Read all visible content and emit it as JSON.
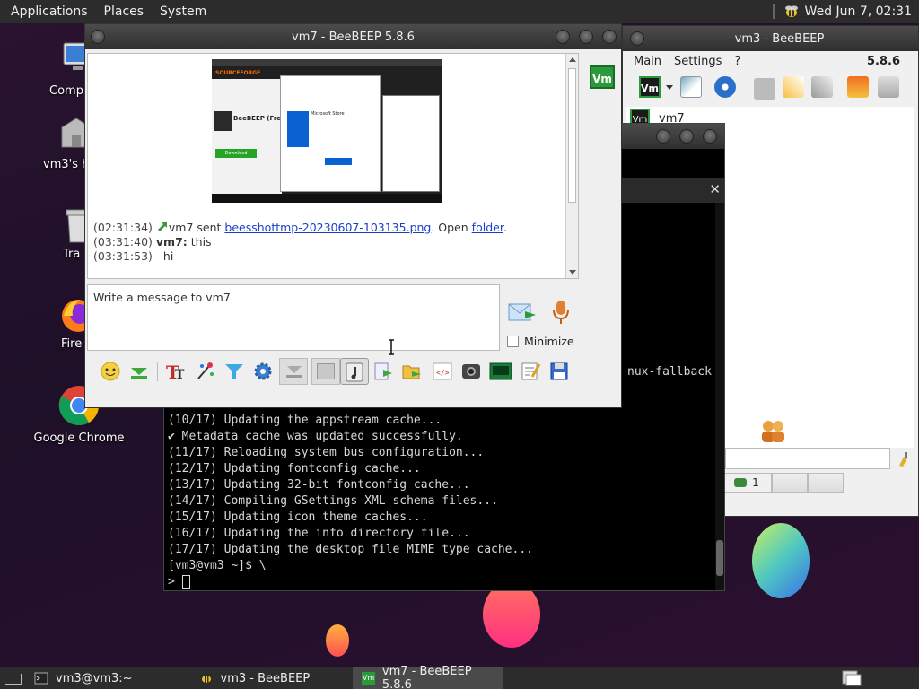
{
  "top_panel": {
    "menus": [
      "Applications",
      "Places",
      "System"
    ],
    "clock": "Wed Jun  7, 02:31"
  },
  "desktop": {
    "icons": [
      {
        "label": "Comp",
        "icon": "computer-icon"
      },
      {
        "label": "vm3's h",
        "icon": "home-folder-icon"
      },
      {
        "label": "Tra",
        "icon": "trash-icon"
      },
      {
        "label": "Fire",
        "icon": "firefox-icon"
      },
      {
        "label": "Google Chrome",
        "icon": "chrome-icon"
      }
    ]
  },
  "bottom_panel": {
    "tasks": [
      {
        "label": "vm3@vm3:~",
        "icon": "terminal-icon"
      },
      {
        "label": "vm3 - BeeBEEP",
        "icon": "beebeep-icon"
      },
      {
        "label": "vm7 - BeeBEEP 5.8.6",
        "icon": "vm-avatar-icon"
      }
    ]
  },
  "terminal": {
    "partial": "nux-fallback",
    "lines": [
      "(10/17) Updating the appstream cache...",
      "✔ Metadata cache was updated successfully.",
      "(11/17) Reloading system bus configuration...",
      "(12/17) Updating fontconfig cache...",
      "(13/17) Updating 32-bit fontconfig cache...",
      "(14/17) Compiling GSettings XML schema files...",
      "(15/17) Updating icon theme caches...",
      "(16/17) Updating the info directory file...",
      "(17/17) Updating the desktop file MIME type cache...",
      "[vm3@vm3 ~]$ \\",
      ">"
    ]
  },
  "bg_window": {
    "title": "vm3 - BeeBEEP",
    "menu": [
      "Main",
      "Settings",
      "?"
    ],
    "version": "5.8.6",
    "user": "vm7",
    "avatar": "Vm",
    "count": "1"
  },
  "chat_window": {
    "title": "vm7 - BeeBEEP 5.8.6",
    "avatar": "Vm",
    "messages": [
      {
        "time": "(02:31:34)",
        "user": "vm7",
        "text_pre": " sent ",
        "file": "beesshottmp-20230607-103135.png",
        "text_mid": ". Open ",
        "folder": "folder",
        "text_post": "."
      },
      {
        "time": "(03:31:40)",
        "user": "vm7:",
        "text": " this"
      },
      {
        "time": "(03:31:53)",
        "text": "hi"
      }
    ],
    "input_placeholder": "Write a message to vm7",
    "minimize_label": "Minimize",
    "screenshot": {
      "brand": "SOURCEFORGE",
      "app": "BeeBEEP (Free",
      "download": "Download",
      "store": "Microsoft Store"
    }
  }
}
